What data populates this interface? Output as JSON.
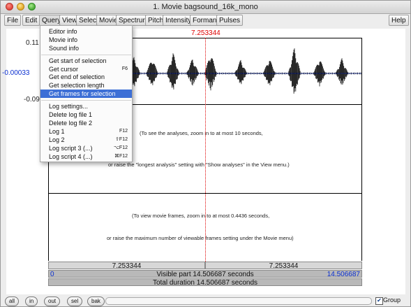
{
  "window": {
    "title": "1. Movie bagsound_16k_mono"
  },
  "menubar": {
    "items": [
      "File",
      "Edit",
      "Query",
      "View",
      "Select",
      "Movie",
      "Spectrum",
      "Pitch",
      "Intensity",
      "Formant",
      "Pulses"
    ],
    "help_label": "Help"
  },
  "query_menu": {
    "items": [
      {
        "label": "Editor info",
        "shortcut": ""
      },
      {
        "label": "Movie info",
        "shortcut": ""
      },
      {
        "label": "Sound info",
        "shortcut": ""
      },
      {
        "label": "Get start of selection",
        "shortcut": ""
      },
      {
        "label": "Get cursor",
        "shortcut": "F6"
      },
      {
        "label": "Get end of selection",
        "shortcut": ""
      },
      {
        "label": "Get selection length",
        "shortcut": ""
      },
      {
        "label": "Get frames for selection",
        "shortcut": ""
      },
      {
        "label": "Log settings...",
        "shortcut": ""
      },
      {
        "label": "Delete log file 1",
        "shortcut": ""
      },
      {
        "label": "Delete log file 2",
        "shortcut": ""
      },
      {
        "label": "Log 1",
        "shortcut": "F12"
      },
      {
        "label": "Log 2",
        "shortcut": "⇧F12"
      },
      {
        "label": "Log script 3 (...)",
        "shortcut": "⌥F12"
      },
      {
        "label": "Log script 4 (...)",
        "shortcut": "⌘F12"
      }
    ],
    "highlighted_index": 7
  },
  "sound_pane": {
    "y_top": "0.11",
    "y_mid": "-0.00033",
    "y_bottom": "-0.09",
    "cursor_time": "7.253344"
  },
  "messages": {
    "analysis_line1": "(To see the analyses, zoom in to at most 10 seconds,",
    "analysis_line2": "or raise the \"longest analysis\" setting with \"Show analyses\" in the View menu.)",
    "movie_line1": "(To view movie frames, zoom in to at most 0.4436 seconds,",
    "movie_line2": "or raise the maximum number of viewable frames setting under the Movie menu)"
  },
  "time_bars": {
    "left_segment": "7.253344",
    "right_segment": "7.253344",
    "visible_start": "0",
    "visible_label": "Visible part 14.506687 seconds",
    "visible_end": "14.506687",
    "total_label": "Total duration 14.506687 seconds"
  },
  "statusbar": {
    "buttons": [
      "all",
      "in",
      "out",
      "sel",
      "bak"
    ],
    "group_label": "Group",
    "group_checked": true
  },
  "colors": {
    "cursor": "#dd0000",
    "menu_highlight": "#3d6fd6",
    "time_link": "#0a2fd0"
  }
}
